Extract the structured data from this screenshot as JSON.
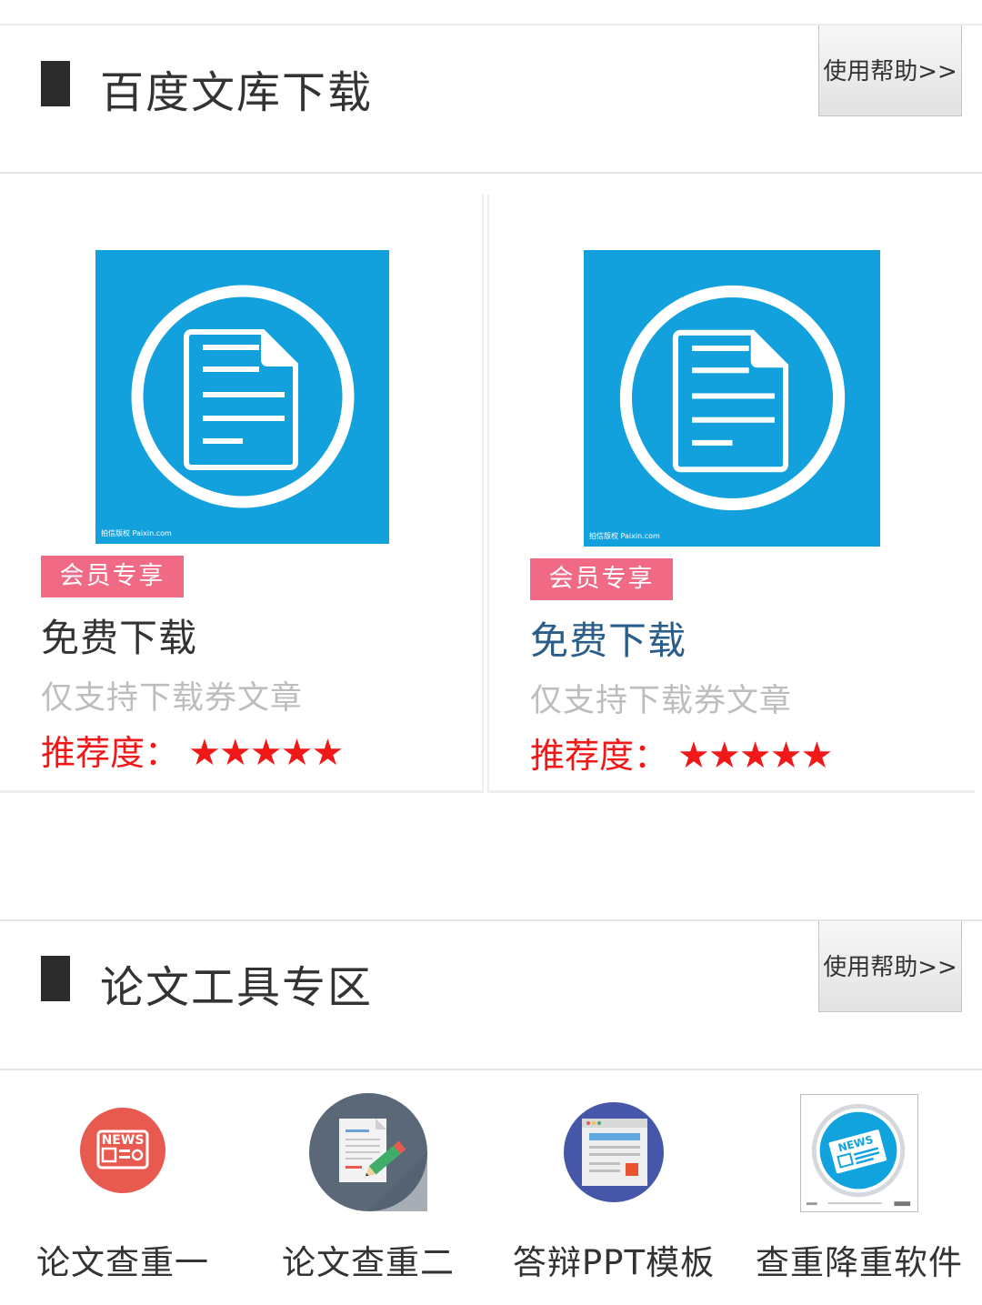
{
  "sections": [
    {
      "title": "百度文库下载",
      "help_label": "使用帮助>>"
    },
    {
      "title": "论文工具专区",
      "help_label": "使用帮助>>"
    }
  ],
  "cards": [
    {
      "badge": "会员专享",
      "title": "免费下载",
      "subtitle": "仅支持下载券文章",
      "rating_label": "推荐度：",
      "stars": "★★★★★",
      "rating": 5,
      "watermark": "拍信版权 Paixin.com"
    },
    {
      "badge": "会员专享",
      "title": "免费下载",
      "subtitle": "仅支持下载券文章",
      "rating_label": "推荐度：",
      "stars": "★★★★★",
      "rating": 5,
      "watermark": "拍信版权 Paixin.com"
    }
  ],
  "tools": [
    {
      "label": "论文查重一",
      "icon": "news-icon",
      "icon_text": "NEWS"
    },
    {
      "label": "论文查重二",
      "icon": "document-edit-icon"
    },
    {
      "label": "答辩PPT模板",
      "icon": "presentation-icon"
    },
    {
      "label": "查重降重软件",
      "icon": "newspaper-icon",
      "icon_text": "NEWS"
    }
  ],
  "colors": {
    "accent_blue": "#12a1dc",
    "badge_pink": "#f06a86",
    "rating_red": "#f01818",
    "link_blue": "#2a5d8a",
    "title_dark": "#333333"
  }
}
